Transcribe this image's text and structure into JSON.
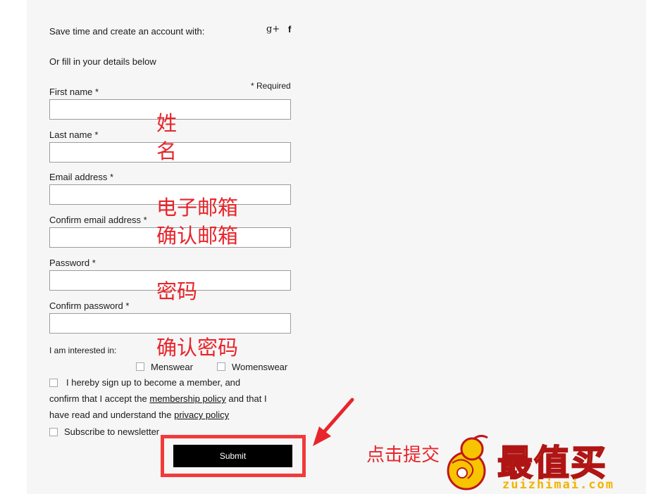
{
  "social": {
    "prompt": "Save time and create an account with:",
    "google_icon": "g+",
    "facebook_icon": "f"
  },
  "fill_prompt": "Or fill in your details below",
  "required_note": "* Required",
  "fields": {
    "first_name": {
      "label": "First name *",
      "value": ""
    },
    "last_name": {
      "label": "Last name *",
      "value": ""
    },
    "email": {
      "label": "Email address *",
      "value": ""
    },
    "confirm_email": {
      "label": "Confirm email address *",
      "value": ""
    },
    "password": {
      "label": "Password *",
      "value": ""
    },
    "confirm_password": {
      "label": "Confirm password *",
      "value": ""
    }
  },
  "interests": {
    "label": "I am interested in:",
    "menswear": "Menswear",
    "womenswear": "Womenswear"
  },
  "membership": {
    "line1": "I hereby sign up to become a member, and",
    "line2a": "confirm that I accept the ",
    "policy_link": "membership policy",
    "line2b": " and that I",
    "line3a": "have read and understand the ",
    "privacy_link": "privacy policy"
  },
  "newsletter_label": "Subscribe to newsletter",
  "submit_label": "Submit",
  "annotations": {
    "name_a": "姓",
    "name_b": "名",
    "email": "电子邮箱",
    "confirm_email": "确认邮箱",
    "password": "密码",
    "confirm_password": "确认密码",
    "click_submit": "点击提交"
  },
  "watermark": {
    "brand": "最值买",
    "domain": "zuizhimai.com"
  },
  "colors": {
    "panel_bg": "#f6f6f6",
    "annotation_red": "#e8252b",
    "submit_bg": "#000000",
    "logo_yellow": "#f5c400"
  }
}
